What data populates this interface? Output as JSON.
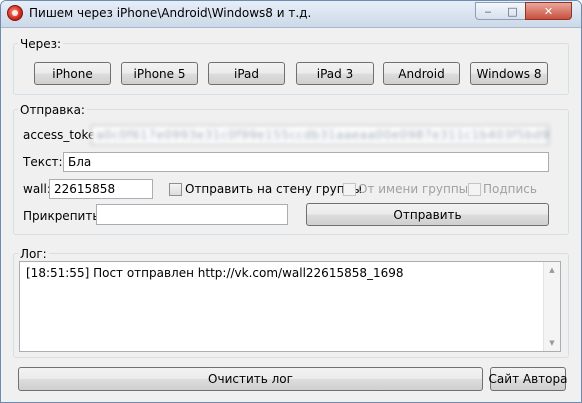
{
  "window": {
    "title": "Пишем через iPhone\\Android\\Windows8  и т.д.",
    "minimize_glyph": "‒",
    "maximize_glyph": "□",
    "close_glyph": "✕"
  },
  "via": {
    "label": "Через:",
    "buttons": [
      "iPhone",
      "iPhone 5",
      "iPad",
      "iPad 3",
      "Android",
      "Windows 8"
    ]
  },
  "send": {
    "label": "Отправка:",
    "access_token_label": "access_token:",
    "access_token_value": "a0c0f617e0993e31c0f99e155ccdb31aaeaa00e0987e311c1b403f5bd91",
    "text_label": "Текст:",
    "text_value": "Бла",
    "wall_label": "wall:",
    "wall_value": "22615858",
    "post_to_group_label": "Отправить на стену группы",
    "from_group_label": "От имени группы",
    "signature_label": "Подпись",
    "attach_label": "Прикрепить:",
    "attach_value": "",
    "send_button": "Отправить"
  },
  "log": {
    "label": "Лог:",
    "lines": [
      "[18:51:55] Пост отправлен http://vk.com/wall22615858_1698"
    ]
  },
  "footer": {
    "clear_log_button": "Очистить лог",
    "author_site_button": "Сайт Автора"
  }
}
